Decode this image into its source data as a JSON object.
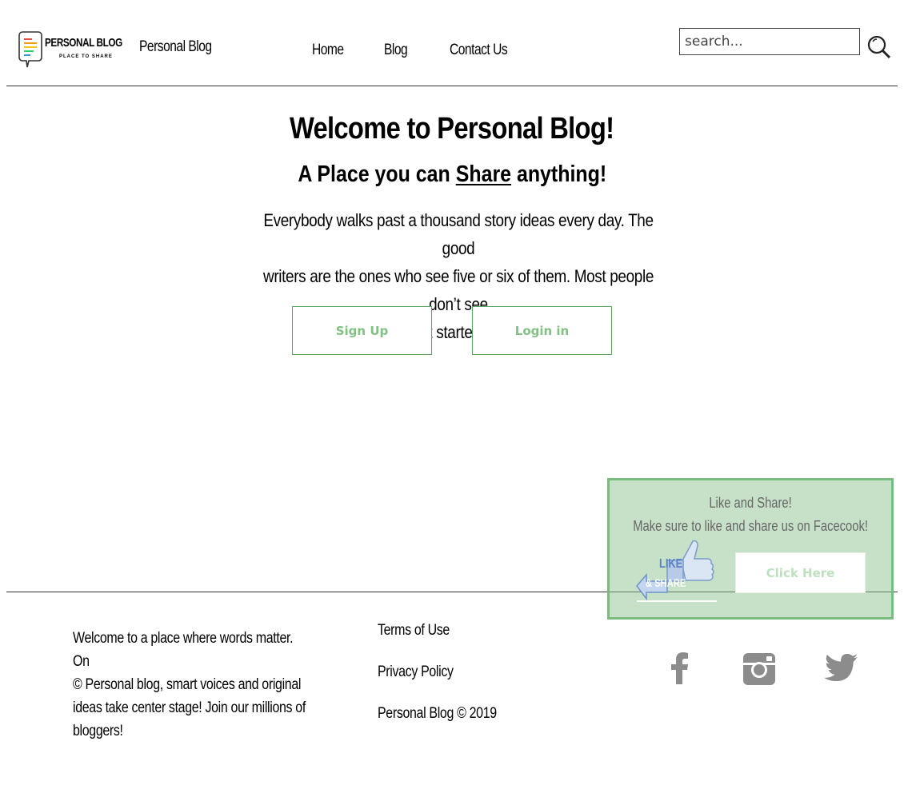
{
  "header": {
    "logo_text": "PERSONAL BLOG",
    "logo_tagline": "PLACE TO SHARE",
    "site_name": "Personal Blog",
    "nav": [
      {
        "label": "Home"
      },
      {
        "label": "Blog"
      },
      {
        "label": "Contact Us"
      }
    ],
    "search": {
      "placeholder": "search...",
      "value": "",
      "icon": "magnifier-icon"
    }
  },
  "hero": {
    "title": "Welcome to Personal Blog!",
    "subtitle_before": "A Place you can ",
    "subtitle_link": "Share",
    "subtitle_after": " anything!",
    "body_lines": [
      "Everybody walks past a thousand story ideas every day. The good",
      "writers are the ones who see five or six of them. Most people don’t see",
      "any. Let's get started writing today!"
    ],
    "signup_label": "Sign Up",
    "login_label": "Login in"
  },
  "like_share": {
    "title": "Like and Share!",
    "text": "Make sure to like and share us on Facecook!",
    "image_label_1": "LIKE",
    "image_label_2": "& SHARE",
    "button_label": "Click Here"
  },
  "footer": {
    "about_lines": [
      "Welcome to a place where words matter. On",
      "© Personal blog, smart voices and original",
      "ideas take center stage! Join our millions of",
      "bloggers!"
    ],
    "terms": "Terms of Use",
    "privacy": "Privacy Policy",
    "copyright": "Personal Blog © 2019",
    "social_icons": [
      "facebook-icon",
      "instagram-icon",
      "twitter-icon"
    ]
  },
  "colors": {
    "accent_green": "#5aa55f",
    "button_text_green": "#82c084",
    "social_grey": "#8c8c8c"
  }
}
